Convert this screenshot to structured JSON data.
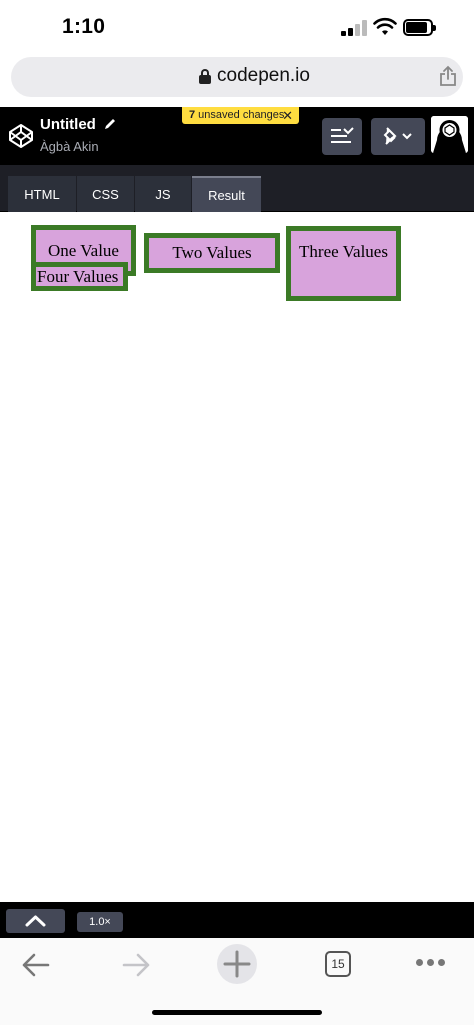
{
  "status_bar": {
    "time": "1:10"
  },
  "browser": {
    "url": "codepen.io",
    "tab_count": "15"
  },
  "codepen": {
    "pen_title": "Untitled",
    "author": "Àgbà Akin",
    "unsaved": {
      "count": "7",
      "text": " unsaved changes",
      "close": "✕"
    },
    "tabs": [
      "HTML",
      "CSS",
      "JS",
      "Result"
    ],
    "active_tab": "Result",
    "zoom": "1.0×"
  },
  "result": {
    "boxes": [
      "One Value",
      "Two Values",
      "Three Values",
      "Four Values"
    ]
  },
  "colors": {
    "box_fill": "#d8a3dc",
    "box_border": "#3b7a26",
    "unsaved_badge": "#ffdd40",
    "header_bg": "#000000",
    "tab_bg": "#2c303a"
  },
  "icons": [
    "lock-icon",
    "share-icon",
    "codepen-logo-icon",
    "pencil-icon",
    "layout-icon",
    "pin-icon",
    "chevron-down-icon",
    "chevron-up-icon",
    "back-arrow-icon",
    "forward-arrow-icon",
    "plus-icon",
    "more-icon"
  ]
}
